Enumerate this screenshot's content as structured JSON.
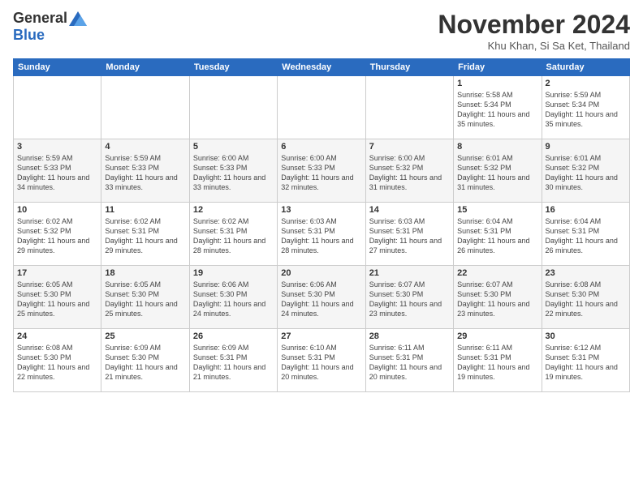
{
  "header": {
    "logo_general": "General",
    "logo_blue": "Blue",
    "month_title": "November 2024",
    "location": "Khu Khan, Si Sa Ket, Thailand"
  },
  "weekdays": [
    "Sunday",
    "Monday",
    "Tuesday",
    "Wednesday",
    "Thursday",
    "Friday",
    "Saturday"
  ],
  "weeks": [
    [
      {
        "day": "",
        "info": ""
      },
      {
        "day": "",
        "info": ""
      },
      {
        "day": "",
        "info": ""
      },
      {
        "day": "",
        "info": ""
      },
      {
        "day": "",
        "info": ""
      },
      {
        "day": "1",
        "info": "Sunrise: 5:58 AM\nSunset: 5:34 PM\nDaylight: 11 hours and 35 minutes."
      },
      {
        "day": "2",
        "info": "Sunrise: 5:59 AM\nSunset: 5:34 PM\nDaylight: 11 hours and 35 minutes."
      }
    ],
    [
      {
        "day": "3",
        "info": "Sunrise: 5:59 AM\nSunset: 5:33 PM\nDaylight: 11 hours and 34 minutes."
      },
      {
        "day": "4",
        "info": "Sunrise: 5:59 AM\nSunset: 5:33 PM\nDaylight: 11 hours and 33 minutes."
      },
      {
        "day": "5",
        "info": "Sunrise: 6:00 AM\nSunset: 5:33 PM\nDaylight: 11 hours and 33 minutes."
      },
      {
        "day": "6",
        "info": "Sunrise: 6:00 AM\nSunset: 5:33 PM\nDaylight: 11 hours and 32 minutes."
      },
      {
        "day": "7",
        "info": "Sunrise: 6:00 AM\nSunset: 5:32 PM\nDaylight: 11 hours and 31 minutes."
      },
      {
        "day": "8",
        "info": "Sunrise: 6:01 AM\nSunset: 5:32 PM\nDaylight: 11 hours and 31 minutes."
      },
      {
        "day": "9",
        "info": "Sunrise: 6:01 AM\nSunset: 5:32 PM\nDaylight: 11 hours and 30 minutes."
      }
    ],
    [
      {
        "day": "10",
        "info": "Sunrise: 6:02 AM\nSunset: 5:32 PM\nDaylight: 11 hours and 29 minutes."
      },
      {
        "day": "11",
        "info": "Sunrise: 6:02 AM\nSunset: 5:31 PM\nDaylight: 11 hours and 29 minutes."
      },
      {
        "day": "12",
        "info": "Sunrise: 6:02 AM\nSunset: 5:31 PM\nDaylight: 11 hours and 28 minutes."
      },
      {
        "day": "13",
        "info": "Sunrise: 6:03 AM\nSunset: 5:31 PM\nDaylight: 11 hours and 28 minutes."
      },
      {
        "day": "14",
        "info": "Sunrise: 6:03 AM\nSunset: 5:31 PM\nDaylight: 11 hours and 27 minutes."
      },
      {
        "day": "15",
        "info": "Sunrise: 6:04 AM\nSunset: 5:31 PM\nDaylight: 11 hours and 26 minutes."
      },
      {
        "day": "16",
        "info": "Sunrise: 6:04 AM\nSunset: 5:31 PM\nDaylight: 11 hours and 26 minutes."
      }
    ],
    [
      {
        "day": "17",
        "info": "Sunrise: 6:05 AM\nSunset: 5:30 PM\nDaylight: 11 hours and 25 minutes."
      },
      {
        "day": "18",
        "info": "Sunrise: 6:05 AM\nSunset: 5:30 PM\nDaylight: 11 hours and 25 minutes."
      },
      {
        "day": "19",
        "info": "Sunrise: 6:06 AM\nSunset: 5:30 PM\nDaylight: 11 hours and 24 minutes."
      },
      {
        "day": "20",
        "info": "Sunrise: 6:06 AM\nSunset: 5:30 PM\nDaylight: 11 hours and 24 minutes."
      },
      {
        "day": "21",
        "info": "Sunrise: 6:07 AM\nSunset: 5:30 PM\nDaylight: 11 hours and 23 minutes."
      },
      {
        "day": "22",
        "info": "Sunrise: 6:07 AM\nSunset: 5:30 PM\nDaylight: 11 hours and 23 minutes."
      },
      {
        "day": "23",
        "info": "Sunrise: 6:08 AM\nSunset: 5:30 PM\nDaylight: 11 hours and 22 minutes."
      }
    ],
    [
      {
        "day": "24",
        "info": "Sunrise: 6:08 AM\nSunset: 5:30 PM\nDaylight: 11 hours and 22 minutes."
      },
      {
        "day": "25",
        "info": "Sunrise: 6:09 AM\nSunset: 5:30 PM\nDaylight: 11 hours and 21 minutes."
      },
      {
        "day": "26",
        "info": "Sunrise: 6:09 AM\nSunset: 5:31 PM\nDaylight: 11 hours and 21 minutes."
      },
      {
        "day": "27",
        "info": "Sunrise: 6:10 AM\nSunset: 5:31 PM\nDaylight: 11 hours and 20 minutes."
      },
      {
        "day": "28",
        "info": "Sunrise: 6:11 AM\nSunset: 5:31 PM\nDaylight: 11 hours and 20 minutes."
      },
      {
        "day": "29",
        "info": "Sunrise: 6:11 AM\nSunset: 5:31 PM\nDaylight: 11 hours and 19 minutes."
      },
      {
        "day": "30",
        "info": "Sunrise: 6:12 AM\nSunset: 5:31 PM\nDaylight: 11 hours and 19 minutes."
      }
    ]
  ]
}
